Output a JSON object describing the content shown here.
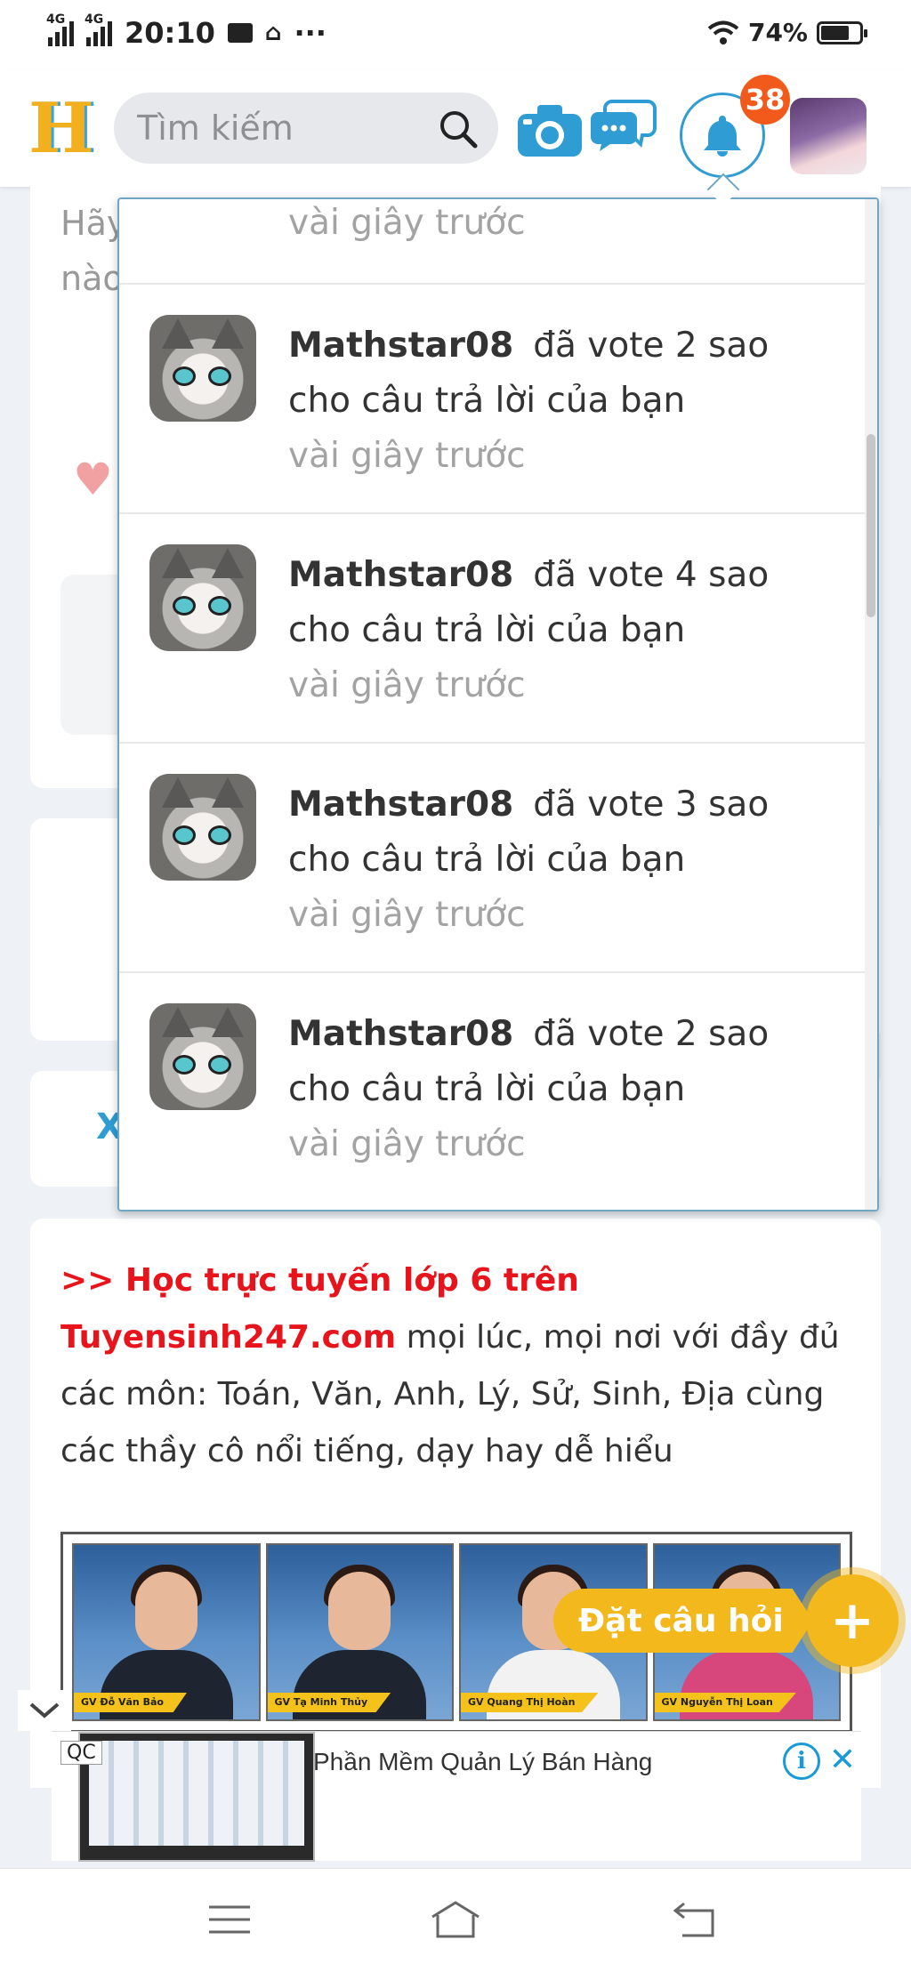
{
  "status_bar": {
    "network1": "4G",
    "network2": "4G",
    "time": "20:10",
    "more": "···",
    "battery": "74%",
    "battery_level": 0.74
  },
  "header": {
    "search_placeholder": "Tìm kiếm",
    "notification_count": "38"
  },
  "background": {
    "question_text_1": "Hãy",
    "question_text_2": "nào",
    "card3_label": "X"
  },
  "notifications": {
    "first_time": "vài giây trước",
    "items": [
      {
        "user": "Mathstar08",
        "action": "đã vote 2 sao cho câu trả lời của bạn",
        "time": "vài giây trước"
      },
      {
        "user": "Mathstar08",
        "action": "đã vote 4 sao cho câu trả lời của bạn",
        "time": "vài giây trước"
      },
      {
        "user": "Mathstar08",
        "action": "đã vote 3 sao cho câu trả lời của bạn",
        "time": "vài giây trước"
      },
      {
        "user": "Mathstar08",
        "action": "đã vote 2 sao cho câu trả lời của bạn",
        "time": "vài giây trước"
      }
    ]
  },
  "promo": {
    "headline": ">> Học trực tuyến lớp 6 trên Tuyensinh247.com",
    "body": "mọi lúc, mọi nơi với đầy đủ các môn: Toán, Văn, Anh, Lý, Sử, Sinh, Địa cùng các thầy cô nổi tiếng, dạy hay dễ hiểu",
    "teachers": [
      "GV Đỗ Văn Bảo",
      "GV Tạ Minh Thủy",
      "GV Quang Thị Hoàn",
      "GV Nguyễn Thị Loan"
    ]
  },
  "ask_button": {
    "label": "Đặt câu hỏi",
    "plus": "+"
  },
  "ad": {
    "label": "QC",
    "title": "Phần Mềm Quản Lý Bán Hàng",
    "info": "i",
    "close": "✕"
  },
  "colors": {
    "accent": "#2f9dd4",
    "badge": "#f25a1b",
    "promo_red": "#e8141b",
    "ask_yellow": "#f2b81c"
  }
}
